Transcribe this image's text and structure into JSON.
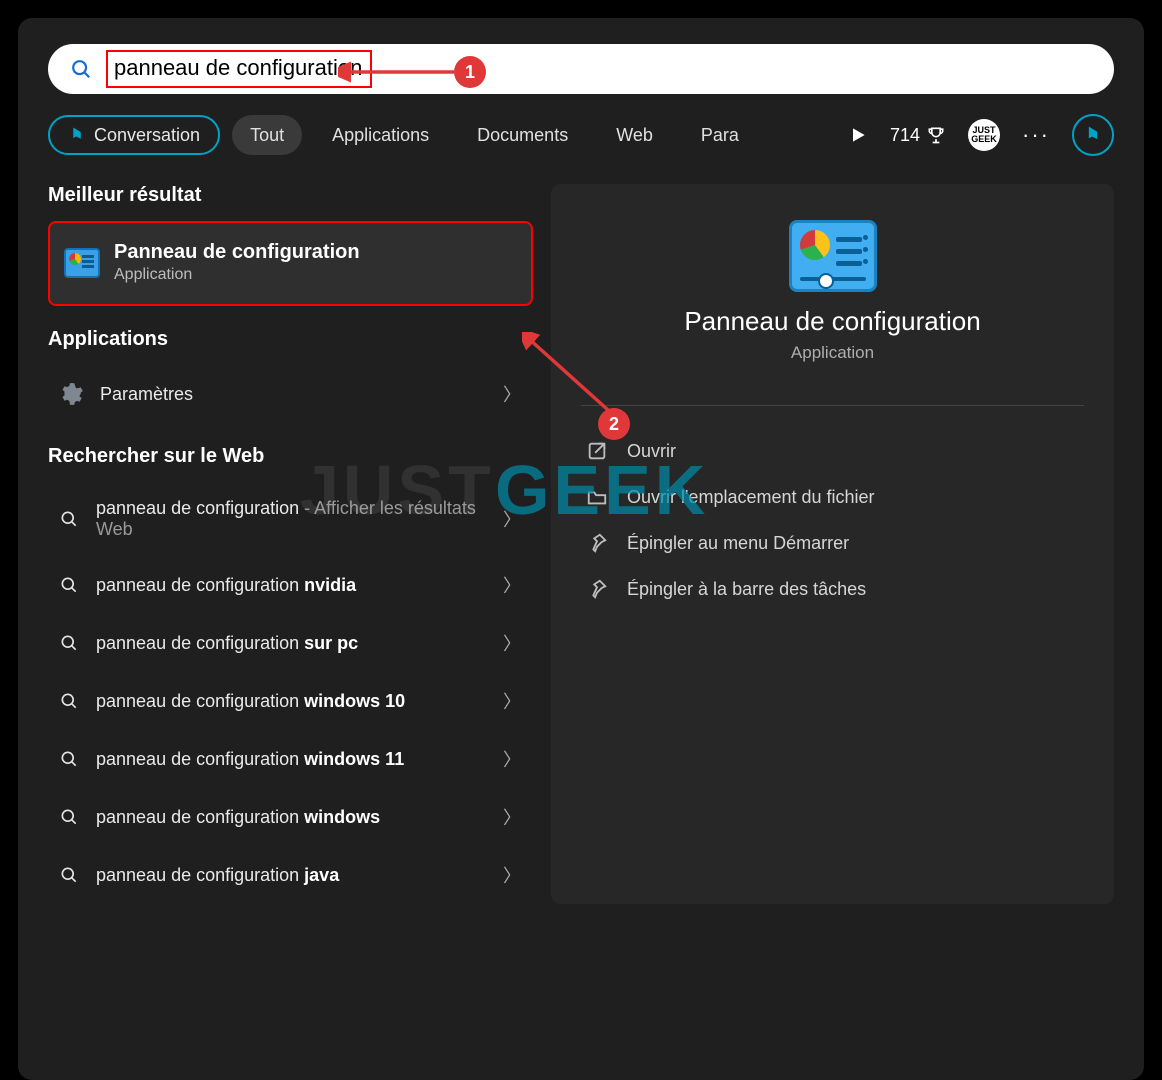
{
  "search": {
    "query": "panneau de configuration"
  },
  "filters": {
    "conversation": "Conversation",
    "all": "Tout",
    "apps": "Applications",
    "docs": "Documents",
    "web": "Web",
    "more_trunc": "Para"
  },
  "top": {
    "points": "714",
    "avatar_text": "JUST GEEK"
  },
  "left": {
    "best_header": "Meilleur résultat",
    "best": {
      "title": "Panneau de configuration",
      "subtitle": "Application"
    },
    "apps_header": "Applications",
    "apps": [
      {
        "label": "Paramètres"
      }
    ],
    "web_header": "Rechercher sur le Web",
    "web": [
      {
        "prefix": "panneau de configuration",
        "bold": "",
        "suffix": " - Afficher les résultats Web"
      },
      {
        "prefix": "panneau de configuration",
        "bold": " nvidia",
        "suffix": ""
      },
      {
        "prefix": "panneau de configuration",
        "bold": " sur pc",
        "suffix": ""
      },
      {
        "prefix": "panneau de configuration",
        "bold": " windows 10",
        "suffix": ""
      },
      {
        "prefix": "panneau de configuration",
        "bold": " windows 11",
        "suffix": ""
      },
      {
        "prefix": "panneau de configuration",
        "bold": " windows",
        "suffix": ""
      },
      {
        "prefix": "panneau de configuration",
        "bold": " java",
        "suffix": ""
      }
    ]
  },
  "right": {
    "title": "Panneau de configuration",
    "subtitle": "Application",
    "actions": {
      "open": "Ouvrir",
      "open_location": "Ouvrir l'emplacement du fichier",
      "pin_start": "Épingler au menu Démarrer",
      "pin_taskbar": "Épingler à la barre des tâches"
    }
  },
  "annotations": {
    "one": "1",
    "two": "2"
  },
  "watermark": {
    "a": "JUST",
    "b": "GEEK"
  }
}
